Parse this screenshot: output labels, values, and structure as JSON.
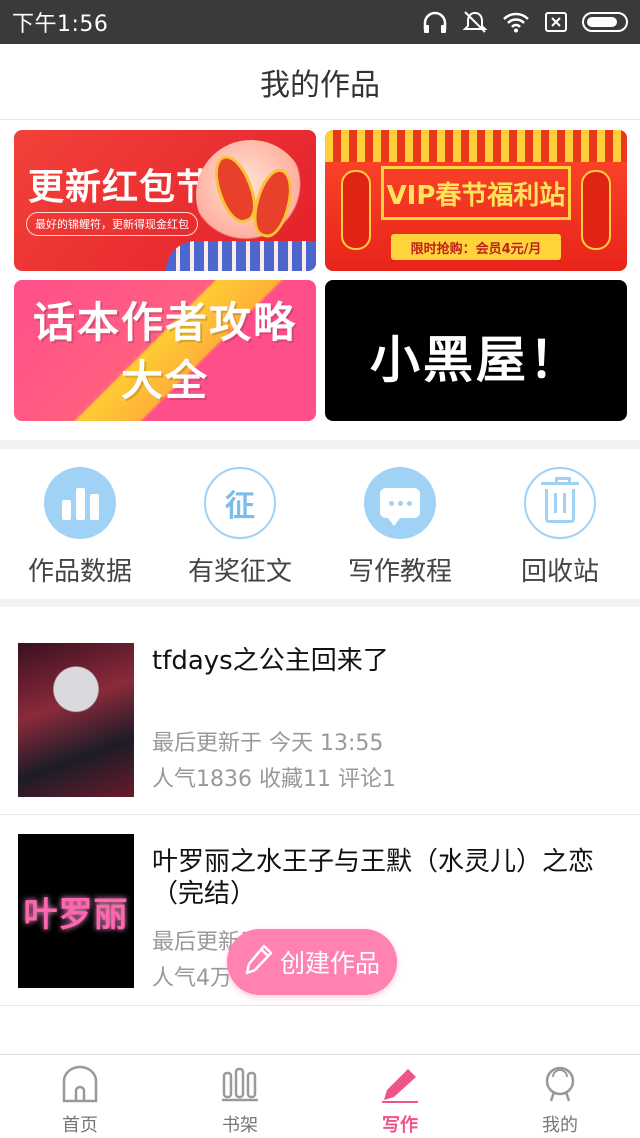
{
  "status_bar": {
    "time": "下午1:56"
  },
  "header": {
    "title": "我的作品"
  },
  "banners": [
    {
      "name": "red-packet",
      "title": "更新红包节",
      "subtitle": "最好的锦鲤符，更新得现金红包"
    },
    {
      "name": "vip-spring",
      "title": "VIP春节福利站",
      "tag": "限时抢购：会员4元/月"
    },
    {
      "name": "author-guide",
      "title_line1": "话本作者攻略",
      "title_line2": "大全"
    },
    {
      "name": "black-house",
      "title": "小黑屋！"
    }
  ],
  "actions": [
    {
      "label": "作品数据",
      "icon": "bar-chart-icon"
    },
    {
      "label": "有奖征文",
      "icon": "contest-icon",
      "glyph": "征"
    },
    {
      "label": "写作教程",
      "icon": "tutorial-chat-icon"
    },
    {
      "label": "回收站",
      "icon": "trash-icon"
    }
  ],
  "works": [
    {
      "title": "tfdays之公主回来了",
      "updated": "最后更新于 今天 13:55",
      "stats": "人气1836 收藏11 评论1"
    },
    {
      "title": "叶罗丽之水王子与王默（水灵儿）之恋（完结）",
      "updated": "最后更新于 01-21",
      "stats": "人气4万",
      "cover_text": "叶罗丽"
    }
  ],
  "fab": {
    "label": "创建作品"
  },
  "bottom_nav": [
    {
      "label": "首页",
      "icon": "home-icon"
    },
    {
      "label": "书架",
      "icon": "bookshelf-icon"
    },
    {
      "label": "写作",
      "icon": "pen-icon",
      "active": true
    },
    {
      "label": "我的",
      "icon": "profile-icon"
    }
  ],
  "colors": {
    "accent_pink": "#f0538a",
    "fab": "#ff82b0",
    "action_blue": "#9fd2f5"
  }
}
